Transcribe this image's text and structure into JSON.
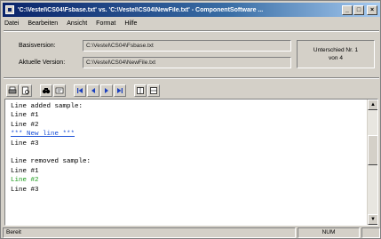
{
  "window": {
    "title": "'C:\\Vestel\\CS04\\Fsbase.txt' vs. 'C:\\Vestel\\CS04\\NewFile.txt' - ComponentSoftware ...",
    "controls": {
      "minimize": "_",
      "maximize": "□",
      "close": "×"
    }
  },
  "menu": {
    "items": [
      {
        "label": "Datei"
      },
      {
        "label": "Bearbeiten"
      },
      {
        "label": "Ansicht"
      },
      {
        "label": "Format"
      },
      {
        "label": "Hilfe"
      }
    ]
  },
  "versions": {
    "base_label": "Basisversion:",
    "base_value": "C:\\Vestel\\CS04\\Fsbase.txt",
    "current_label": "Aktuelle Version:",
    "current_value": "C:\\Vestel\\CS04\\NewFile.txt",
    "info_line1": "Unterschied Nr. 1",
    "info_line2": "von 4"
  },
  "toolbar": {
    "icons": [
      "print-icon",
      "preview-icon",
      "find-icon",
      "options-icon",
      "first-diff-icon",
      "prev-diff-icon",
      "next-diff-icon",
      "last-diff-icon",
      "view-single-icon",
      "view-split-icon"
    ]
  },
  "editor": {
    "lines": [
      {
        "text": "Line added sample:",
        "kind": "normal"
      },
      {
        "text": "Line #1",
        "kind": "normal"
      },
      {
        "text": "Line #2",
        "kind": "normal"
      },
      {
        "text": "*** New line ***",
        "kind": "added"
      },
      {
        "text": "Line #3",
        "kind": "normal"
      },
      {
        "text": "",
        "kind": "normal"
      },
      {
        "text": "Line removed sample:",
        "kind": "normal"
      },
      {
        "text": "Line #1",
        "kind": "normal"
      },
      {
        "text": "Line #2",
        "kind": "removed"
      },
      {
        "text": "Line #3",
        "kind": "normal"
      }
    ]
  },
  "status": {
    "left": "Bereit",
    "mid": "NUM"
  },
  "colors": {
    "added": "#1a4fd6",
    "removed": "#1a9a1a",
    "titlebar_start": "#0a246a"
  }
}
